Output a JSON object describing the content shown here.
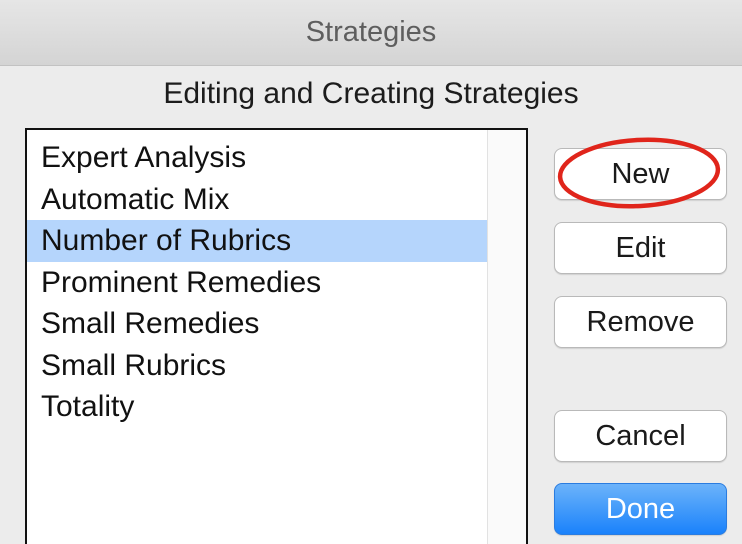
{
  "window": {
    "title": "Strategies",
    "heading": "Editing and Creating Strategies"
  },
  "strategies": {
    "items": [
      {
        "label": "Expert Analysis",
        "selected": false
      },
      {
        "label": "Automatic Mix",
        "selected": false
      },
      {
        "label": "Number of Rubrics",
        "selected": true
      },
      {
        "label": "Prominent Remedies",
        "selected": false
      },
      {
        "label": "Small Remedies",
        "selected": false
      },
      {
        "label": "Small Rubrics",
        "selected": false
      },
      {
        "label": "Totality",
        "selected": false
      }
    ],
    "selection_color": "#b5d5fc"
  },
  "buttons": {
    "new_label": "New",
    "edit_label": "Edit",
    "remove_label": "Remove",
    "cancel_label": "Cancel",
    "done_label": "Done"
  },
  "colors": {
    "annotation": "#e0251b",
    "done_button": "#1a82fb"
  }
}
